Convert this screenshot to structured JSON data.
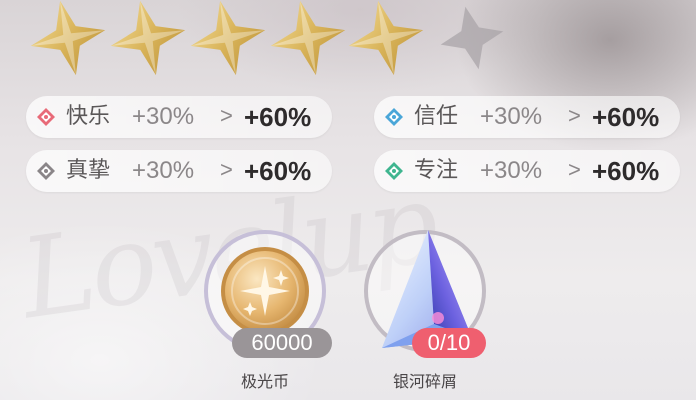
{
  "stars": {
    "filled": 5,
    "total": 6,
    "filled_color": "#d9b45a",
    "empty_color": "#a9a4a8",
    "icon": "four-point-star-icon"
  },
  "stats": [
    {
      "name": "快乐",
      "base": "+30%",
      "arrow": ">",
      "target": "+60%",
      "icon": "diamond-red-icon",
      "color": "#e86a78"
    },
    {
      "name": "信任",
      "base": "+30%",
      "arrow": ">",
      "target": "+60%",
      "icon": "diamond-blue-icon",
      "color": "#4aa6d8"
    },
    {
      "name": "真挚",
      "base": "+30%",
      "arrow": ">",
      "target": "+60%",
      "icon": "diamond-gray-icon",
      "color": "#8a8588"
    },
    {
      "name": "专注",
      "base": "+30%",
      "arrow": ">",
      "target": "+60%",
      "icon": "diamond-green-icon",
      "color": "#3fb58f"
    }
  ],
  "items": [
    {
      "name": "极光币",
      "count": "60000",
      "icon": "gold-coin-icon",
      "badge_color": "#9a9598"
    },
    {
      "name": "银河碎屑",
      "count": "0/10",
      "icon": "crystal-shard-icon",
      "badge_color": "#ef5f6f"
    }
  ]
}
